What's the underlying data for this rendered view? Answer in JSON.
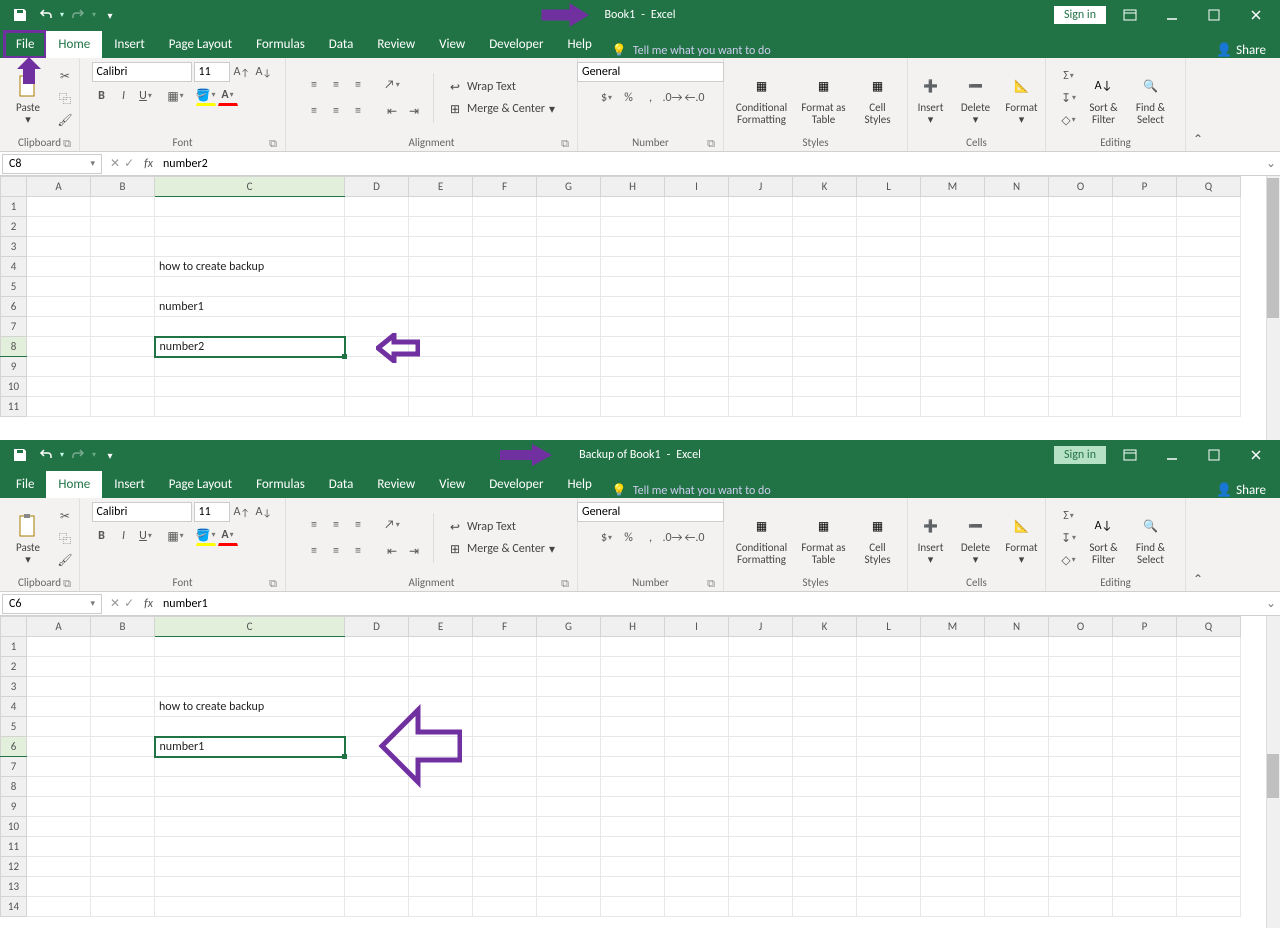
{
  "window1": {
    "title_doc": "Book1",
    "title_app": "Excel",
    "signin": "Sign in",
    "tabs": [
      "File",
      "Home",
      "Insert",
      "Page Layout",
      "Formulas",
      "Data",
      "Review",
      "View",
      "Developer",
      "Help"
    ],
    "active_tab": 1,
    "tellme": "Tell me what you want to do",
    "share": "Share",
    "ribbon": {
      "clipboard": {
        "paste": "Paste",
        "label": "Clipboard"
      },
      "font": {
        "name": "Calibri",
        "size": "11",
        "label": "Font"
      },
      "alignment": {
        "wrap": "Wrap Text",
        "merge": "Merge & Center",
        "label": "Alignment"
      },
      "number": {
        "format": "General",
        "label": "Number"
      },
      "styles": {
        "cond": "Conditional\nFormatting",
        "table": "Format as\nTable",
        "cell": "Cell\nStyles",
        "label": "Styles"
      },
      "cells": {
        "insert": "Insert",
        "delete": "Delete",
        "format": "Format",
        "label": "Cells"
      },
      "editing": {
        "sort": "Sort &\nFilter",
        "find": "Find &\nSelect",
        "label": "Editing"
      }
    },
    "name_box": "C8",
    "formula": "number2",
    "columns": [
      "A",
      "B",
      "C",
      "D",
      "E",
      "F",
      "G",
      "H",
      "I",
      "J",
      "K",
      "L",
      "M",
      "N",
      "O",
      "P",
      "Q"
    ],
    "rows": 11,
    "cells": {
      "C4": "how to create backup",
      "C6": "number1",
      "C8": "number2"
    },
    "selected": {
      "row": 8,
      "col": "C"
    }
  },
  "window2": {
    "title_doc": "Backup of Book1",
    "title_app": "Excel",
    "signin": "Sign in",
    "tabs": [
      "File",
      "Home",
      "Insert",
      "Page Layout",
      "Formulas",
      "Data",
      "Review",
      "View",
      "Developer",
      "Help"
    ],
    "active_tab": 1,
    "tellme": "Tell me what you want to do",
    "share": "Share",
    "name_box": "C6",
    "formula": "number1",
    "columns": [
      "A",
      "B",
      "C",
      "D",
      "E",
      "F",
      "G",
      "H",
      "I",
      "J",
      "K",
      "L",
      "M",
      "N",
      "O",
      "P",
      "Q"
    ],
    "rows": 14,
    "cells": {
      "C4": "how to create backup",
      "C6": "number1"
    },
    "selected": {
      "row": 6,
      "col": "C"
    }
  }
}
